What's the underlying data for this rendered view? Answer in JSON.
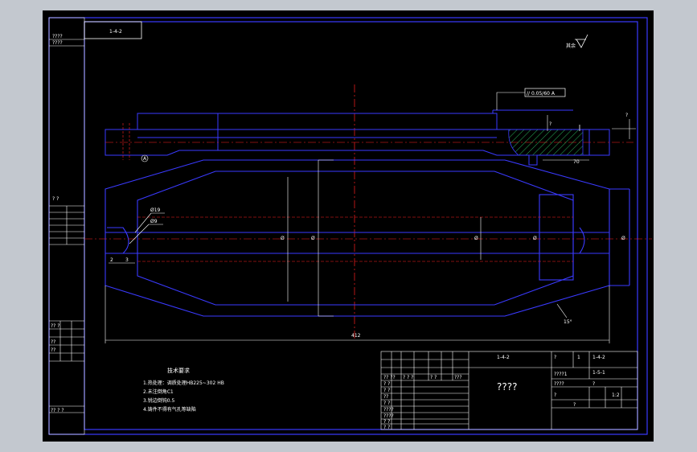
{
  "drawing": {
    "part_code": "1-4-2",
    "part_code_alt": "1-5-1",
    "title_placeholder": "????",
    "scale": "1:2",
    "drawing_no": "????1",
    "material_code": "????"
  },
  "side_labels": {
    "top_left_code": "????",
    "mid_left_pair": "?    ?",
    "lower_left_rows": [
      "?? ?",
      "??",
      "??"
    ],
    "bottom_left_row": "?? ?  ?"
  },
  "roughness": "其余",
  "tolerance_frame": "// 0.05/60  A",
  "datum_label": "A",
  "dimensions": {
    "total_length": "412",
    "bore_label_a": "Ø",
    "left_dia_1": "Ø19",
    "left_dia_2": "Ø9",
    "left_offset_1": "2",
    "left_offset_2": "3",
    "angle": "15°",
    "right_width": "70",
    "right_small": "?",
    "right_top": "?"
  },
  "notes": {
    "title": "技术要求",
    "lines": [
      "1.热处理：调质处理HB225~302 HB",
      "2.未注倒角C1",
      "3.锐边倒钝0.5",
      "4.铸件不得有气孔等缺陷"
    ]
  },
  "title_block": {
    "rows": [
      [
        "?? ??",
        "? ? ?",
        "? ?",
        "???"
      ],
      [
        "? ?"
      ],
      [
        "? ?"
      ],
      [
        "??"
      ],
      [
        "? ?"
      ],
      [
        "????"
      ],
      [
        "????"
      ],
      [
        "? ?"
      ],
      [
        "? ?"
      ]
    ],
    "right_top_a": "?",
    "right_top_b": "1",
    "right_row1": [
      "?",
      "?",
      "?",
      "?"
    ],
    "right_row2": [
      "?",
      "1:2"
    ],
    "right_row3": [
      "?",
      "?",
      "?",
      "?"
    ]
  }
}
